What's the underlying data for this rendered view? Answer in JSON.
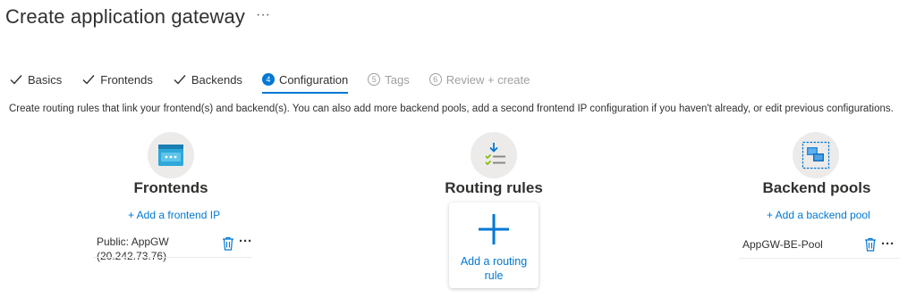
{
  "header": {
    "title": "Create application gateway",
    "more": "···"
  },
  "tabs": [
    {
      "label": "Basics",
      "state": "done"
    },
    {
      "label": "Frontends",
      "state": "done"
    },
    {
      "label": "Backends",
      "state": "done"
    },
    {
      "label": "Configuration",
      "num": "4",
      "state": "active"
    },
    {
      "label": "Tags",
      "num": "5",
      "state": "disabled"
    },
    {
      "label": "Review + create",
      "num": "6",
      "state": "disabled"
    }
  ],
  "description": "Create routing rules that link your frontend(s) and backend(s). You can also add more backend pools, add a second frontend IP configuration if you haven't already, or edit previous configurations.",
  "frontends": {
    "title": "Frontends",
    "add_label": "+ Add a frontend IP",
    "items": [
      {
        "line1": "Public: AppGW",
        "line2": "(20.242.73.76)"
      }
    ],
    "icon": "frontend-icon"
  },
  "routing": {
    "title": "Routing rules",
    "add_label": "Add a routing rule",
    "icon": "routing-rules-icon"
  },
  "backends": {
    "title": "Backend pools",
    "add_label": "+ Add a backend pool",
    "items": [
      {
        "line1": "AppGW-BE-Pool"
      }
    ],
    "icon": "backend-pool-icon"
  },
  "colors": {
    "accent": "#0078d4",
    "text": "#323130",
    "disabled": "#a19f9d"
  }
}
